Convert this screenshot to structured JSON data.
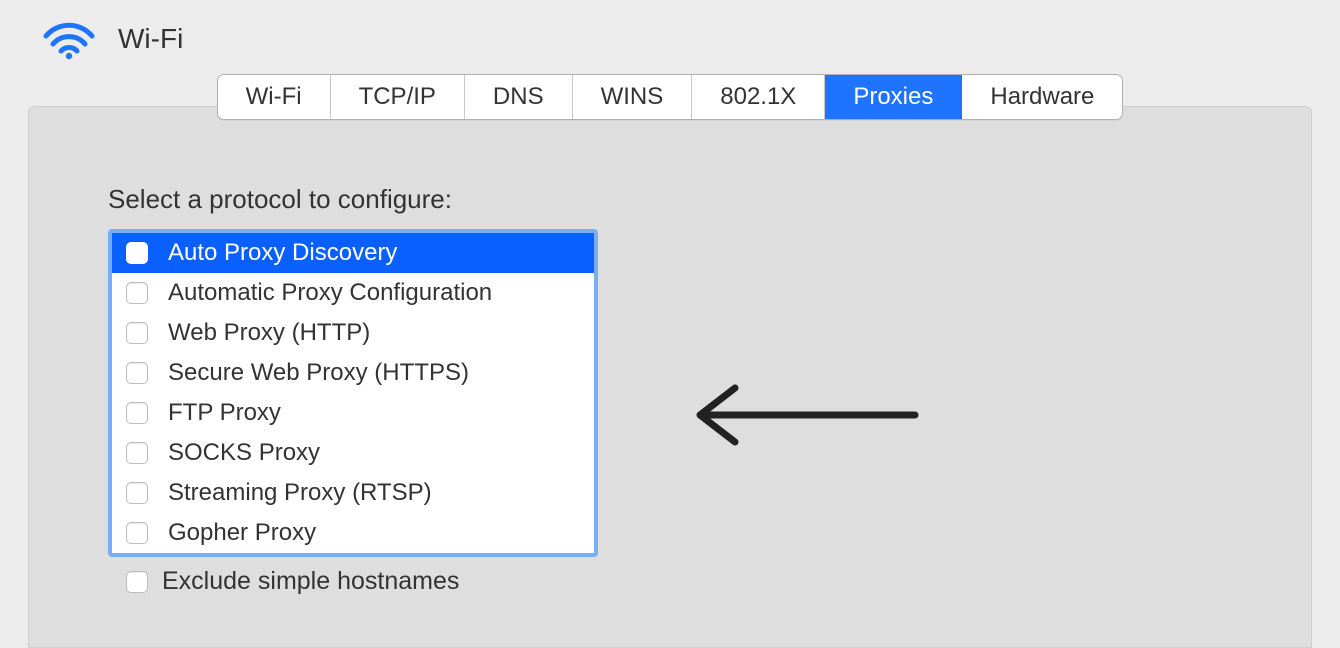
{
  "header": {
    "title": "Wi-Fi"
  },
  "tabs": [
    {
      "label": "Wi-Fi",
      "active": false
    },
    {
      "label": "TCP/IP",
      "active": false
    },
    {
      "label": "DNS",
      "active": false
    },
    {
      "label": "WINS",
      "active": false
    },
    {
      "label": "802.1X",
      "active": false
    },
    {
      "label": "Proxies",
      "active": true
    },
    {
      "label": "Hardware",
      "active": false
    }
  ],
  "protocols": {
    "label": "Select a protocol to configure:",
    "items": [
      {
        "label": "Auto Proxy Discovery",
        "selected": true
      },
      {
        "label": "Automatic Proxy Configuration",
        "selected": false
      },
      {
        "label": "Web Proxy (HTTP)",
        "selected": false
      },
      {
        "label": "Secure Web Proxy (HTTPS)",
        "selected": false
      },
      {
        "label": "FTP Proxy",
        "selected": false
      },
      {
        "label": "SOCKS Proxy",
        "selected": false
      },
      {
        "label": "Streaming Proxy (RTSP)",
        "selected": false
      },
      {
        "label": "Gopher Proxy",
        "selected": false
      }
    ]
  },
  "exclude": {
    "label": "Exclude simple hostnames"
  }
}
